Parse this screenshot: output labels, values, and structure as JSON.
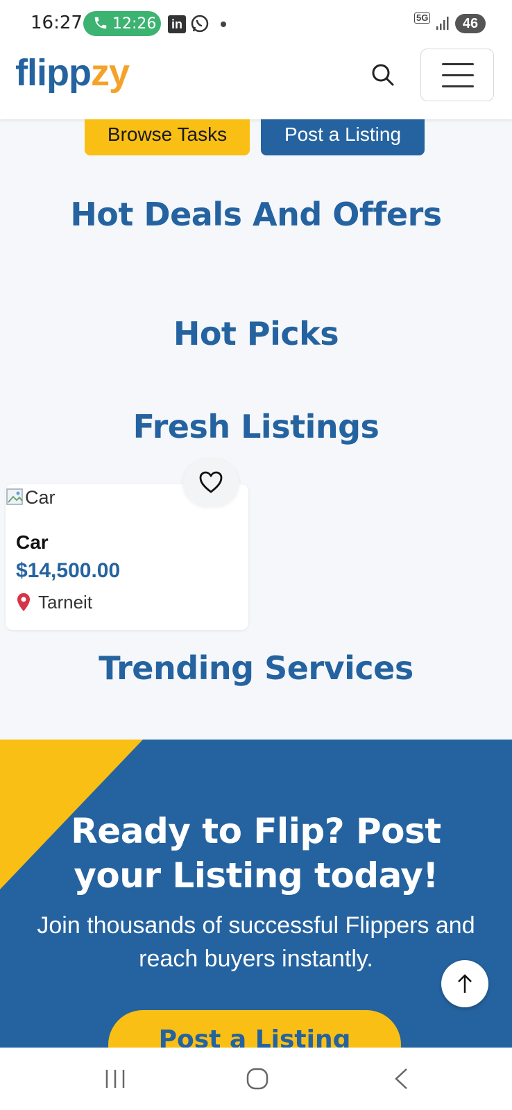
{
  "status_bar": {
    "time": "16:27",
    "call_timer": "12:26",
    "network": "5G",
    "battery": "46",
    "colors": {
      "call_pill": "#3cb371"
    }
  },
  "header": {
    "logo_part1": "flipp",
    "logo_part2": "zy",
    "icons": {
      "search": "search-icon",
      "menu": "hamburger-menu-icon"
    }
  },
  "actions": {
    "browse_tasks": "Browse Tasks",
    "post_listing": "Post a Listing"
  },
  "sections": {
    "hot_deals": "Hot Deals And Offers",
    "hot_picks": "Hot Picks",
    "fresh_listings": "Fresh Listings",
    "trending_services": "Trending Services"
  },
  "listing": {
    "image_alt": "Car",
    "title": "Car",
    "price": "$14,500.00",
    "location": "Tarneit"
  },
  "cta": {
    "title": "Ready to Flip? Post your Listing today!",
    "subtitle": "Join thousands of successful Flippers and reach buyers instantly.",
    "button": "Post a Listing"
  },
  "colors": {
    "brand_blue": "#2563a0",
    "brand_yellow": "#f9bf14",
    "logo_orange": "#f5a22a",
    "page_bg": "#f5f7fa"
  }
}
